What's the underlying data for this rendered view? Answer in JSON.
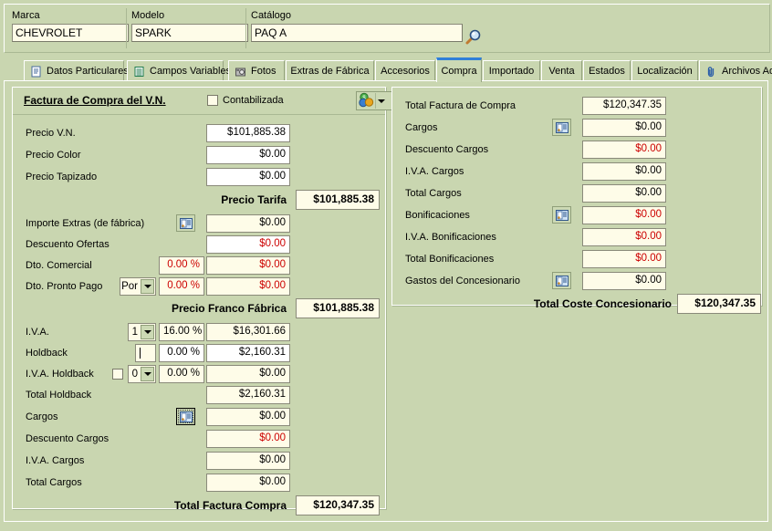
{
  "header": {
    "fields": [
      {
        "label": "Marca",
        "value": "CHEVROLET"
      },
      {
        "label": "Modelo",
        "value": "SPARK"
      },
      {
        "label": "Catálogo",
        "value": "PAQ A"
      }
    ],
    "search_icon": "magnifier-icon"
  },
  "tabs": [
    {
      "label": "Datos Particulares",
      "icon": "document-icon",
      "selected": false
    },
    {
      "label": "Campos Variables",
      "icon": "list-icon",
      "selected": false
    },
    {
      "label": "Fotos",
      "icon": "camera-icon",
      "selected": false
    },
    {
      "label": "Extras de Fábrica",
      "icon": "",
      "selected": false
    },
    {
      "label": "Accesorios",
      "icon": "",
      "selected": false
    },
    {
      "label": "Compra",
      "icon": "",
      "selected": true
    },
    {
      "label": "Importado",
      "icon": "",
      "selected": false
    },
    {
      "label": "Venta",
      "icon": "",
      "selected": false
    },
    {
      "label": "Estados",
      "icon": "",
      "selected": false
    },
    {
      "label": "Localización",
      "icon": "",
      "selected": false
    },
    {
      "label": "Archivos Ad",
      "icon": "paperclip-icon",
      "selected": false
    }
  ],
  "left_panel": {
    "title": "Factura de Compra del V.N.",
    "checkbox_label": "Contabilizada",
    "checkbox_checked": false,
    "currency_button_icon": "currency-icon",
    "rows": [
      {
        "label": "Precio V.N.",
        "value": "$101,885.38",
        "style": "white"
      },
      {
        "label": "Precio Color",
        "value": "$0.00",
        "style": "white"
      },
      {
        "label": "Precio Tapizado",
        "value": "$0.00",
        "style": "white"
      }
    ],
    "subtotal1": {
      "label": "Precio Tarifa",
      "value": "$101,885.38"
    },
    "rows2": [
      {
        "label": "Importe Extras (de fábrica)",
        "value": "$0.00",
        "style": "cream",
        "button": "picture-icon"
      },
      {
        "label": "Descuento Ofertas",
        "value": "$0.00",
        "style": "white-red"
      },
      {
        "label": "Dto. Comercial",
        "value": "$0.00",
        "style": "cream-red",
        "pct": "0.00 %"
      },
      {
        "label": "Dto. Pronto Pago",
        "value": "$0.00",
        "style": "cream-red",
        "pct": "0.00 %",
        "combo": "Por"
      }
    ],
    "subtotal2": {
      "label": "Precio Franco Fábrica",
      "value": "$101,885.38"
    },
    "rows3": [
      {
        "label": "I.V.A.",
        "value": "$16,301.66",
        "style": "cream",
        "pct": "16.00 %",
        "combo": "1"
      },
      {
        "label": "Holdback",
        "value": "$2,160.31",
        "style": "white",
        "pct": "0.00 %",
        "textfield": ""
      },
      {
        "label": "I.V.A. Holdback",
        "value": "$0.00",
        "style": "cream",
        "pct": "0.00 %",
        "combo": "0",
        "checkbox": true
      },
      {
        "label": "Total Holdback",
        "value": "$2,160.31",
        "style": "cream"
      },
      {
        "label": "Cargos",
        "value": "$0.00",
        "style": "cream",
        "button": "picture-icon",
        "focused": true
      },
      {
        "label": "Descuento Cargos",
        "value": "$0.00",
        "style": "cream-red"
      },
      {
        "label": "I.V.A. Cargos",
        "value": "$0.00",
        "style": "cream"
      },
      {
        "label": "Total Cargos",
        "value": "$0.00",
        "style": "cream"
      }
    ],
    "total": {
      "label": "Total Factura Compra",
      "value": "$120,347.35"
    }
  },
  "right_panel": {
    "rows": [
      {
        "label": "Total Factura de Compra",
        "value": "$120,347.35",
        "style": "cream"
      },
      {
        "label": "Cargos",
        "value": "$0.00",
        "style": "cream",
        "button": "picture-icon"
      },
      {
        "label": "Descuento Cargos",
        "value": "$0.00",
        "style": "cream-red"
      },
      {
        "label": "I.V.A. Cargos",
        "value": "$0.00",
        "style": "cream"
      },
      {
        "label": "Total Cargos",
        "value": "$0.00",
        "style": "cream"
      },
      {
        "label": "Bonificaciones",
        "value": "$0.00",
        "style": "cream-red",
        "button": "picture-icon"
      },
      {
        "label": "I.V.A. Bonificaciones",
        "value": "$0.00",
        "style": "cream-red"
      },
      {
        "label": "Total Bonificaciones",
        "value": "$0.00",
        "style": "cream-red"
      },
      {
        "label": "Gastos del Concesionario",
        "value": "$0.00",
        "style": "cream",
        "button": "picture-icon"
      }
    ],
    "total": {
      "label": "Total Coste Concesionario",
      "value": "$120,347.35"
    }
  },
  "colors": {
    "background": "#c9d6b0",
    "field_bg": "#fefce8",
    "accent": "#2f7fd8",
    "negative": "#cc0000"
  }
}
